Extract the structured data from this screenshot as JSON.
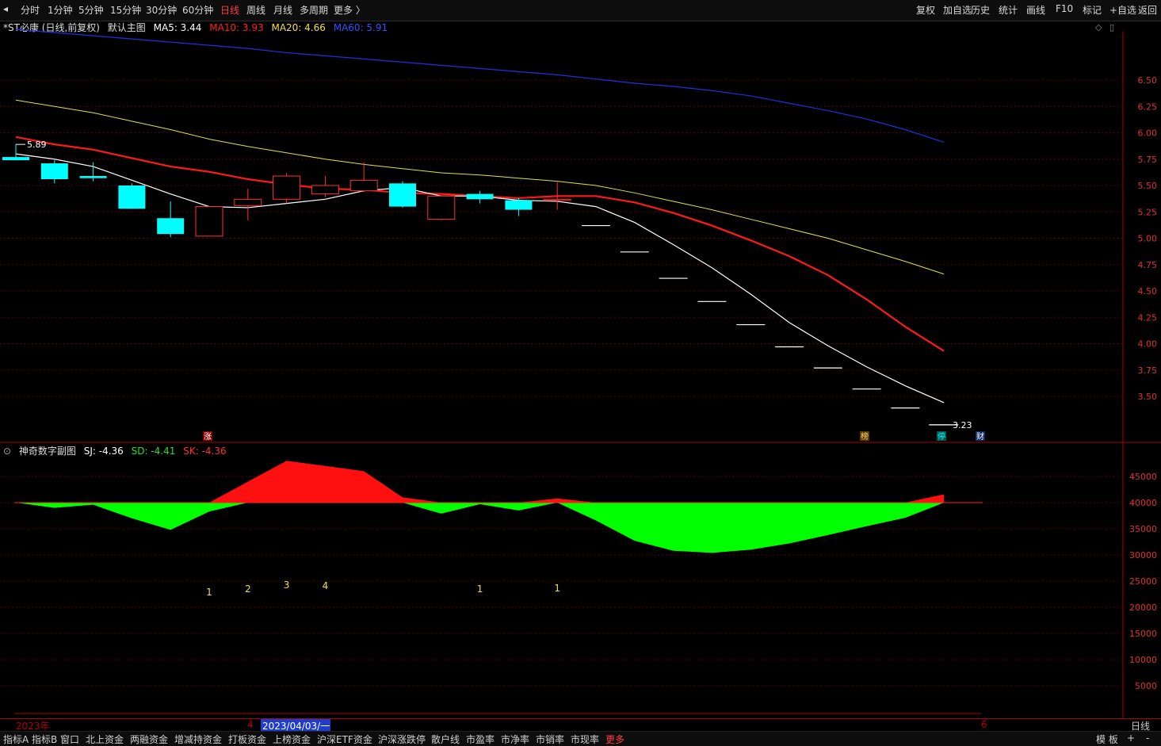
{
  "toolbar": {
    "left_buttons": [
      "分时",
      "1分钟",
      "5分钟",
      "15分钟",
      "30分钟",
      "60分钟",
      "日线",
      "周线",
      "月线",
      "多周期",
      "更多 〉"
    ],
    "active": "日线",
    "right_buttons": [
      "复权",
      "加自选",
      "历史",
      "统计",
      "画线",
      "F10",
      "标记",
      "+自选",
      "返回"
    ]
  },
  "main_legend": {
    "title": "*ST必康 (日线,前复权)",
    "template": "默认主图",
    "ma5": "MA5: 3.44",
    "ma10": "MA10: 3.93",
    "ma20": "MA20: 4.66",
    "ma60": "MA60: 5.91"
  },
  "sub_legend": {
    "title": "神奇数字副图",
    "sj": "SJ: -4.36",
    "sd": "SD: -4.41",
    "sk": "SK: -4.36"
  },
  "annotations": {
    "high_label": "5.89",
    "low_label": "3.23",
    "tag_zhang": "涨",
    "tag_bang": "榜",
    "tag_ting": "停",
    "tag_cai": "财"
  },
  "counts": [
    "1",
    "2",
    "3",
    "4",
    "1",
    "1"
  ],
  "date_axis": {
    "start": "2023年",
    "mid": "4",
    "cursor": "2023/04/03/一",
    "end": "6",
    "period": "日线"
  },
  "bottom_tabs": [
    "指标A",
    "指标B",
    "窗口",
    "北上资金",
    "两融资金",
    "增减持资金",
    "打板资金",
    "上榜资金",
    "沪深ETF资金",
    "沪深涨跌停",
    "散户线",
    "市盈率",
    "市净率",
    "市销率",
    "市现率",
    "更多"
  ],
  "bottom_right": [
    "模 板",
    "+",
    "-"
  ],
  "chart_data": {
    "type": "candlestick",
    "price_axis": {
      "ticks": [
        "6.50",
        "6.25",
        "6.00",
        "5.75",
        "5.50",
        "5.25",
        "5.00",
        "4.75",
        "4.50",
        "4.25",
        "4.00",
        "3.75",
        "3.50"
      ]
    },
    "candles": [
      {
        "open": 5.77,
        "close": 5.74,
        "high": 5.89,
        "low": 5.74,
        "up": false
      },
      {
        "open": 5.71,
        "close": 5.56,
        "high": 5.74,
        "low": 5.52,
        "up": false
      },
      {
        "open": 5.59,
        "close": 5.57,
        "high": 5.72,
        "low": 5.54,
        "up": false
      },
      {
        "open": 5.5,
        "close": 5.28,
        "high": 5.52,
        "low": 5.28,
        "up": false
      },
      {
        "open": 5.19,
        "close": 5.04,
        "high": 5.35,
        "low": 5.01,
        "up": false
      },
      {
        "open": 5.02,
        "close": 5.3,
        "high": 5.3,
        "low": 5.02,
        "up": true
      },
      {
        "open": 5.31,
        "close": 5.37,
        "high": 5.47,
        "low": 5.17,
        "up": true
      },
      {
        "open": 5.37,
        "close": 5.59,
        "high": 5.62,
        "low": 5.33,
        "up": true
      },
      {
        "open": 5.42,
        "close": 5.5,
        "high": 5.59,
        "low": 5.39,
        "up": true
      },
      {
        "open": 5.45,
        "close": 5.55,
        "high": 5.72,
        "low": 5.44,
        "up": true
      },
      {
        "open": 5.52,
        "close": 5.3,
        "high": 5.54,
        "low": 5.29,
        "up": false
      },
      {
        "open": 5.18,
        "close": 5.4,
        "high": 5.41,
        "low": 5.17,
        "up": true
      },
      {
        "open": 5.42,
        "close": 5.37,
        "high": 5.45,
        "low": 5.33,
        "up": false
      },
      {
        "open": 5.36,
        "close": 5.27,
        "high": 5.38,
        "low": 5.21,
        "up": false
      },
      {
        "open": 5.37,
        "close": 5.37,
        "high": 5.53,
        "low": 5.27,
        "up": true
      },
      {
        "open": 5.12,
        "close": 5.12,
        "high": 5.12,
        "low": 5.12,
        "up": false
      },
      {
        "open": 4.87,
        "close": 4.87,
        "high": 4.87,
        "low": 4.87,
        "up": false
      },
      {
        "open": 4.62,
        "close": 4.62,
        "high": 4.62,
        "low": 4.62,
        "up": false
      },
      {
        "open": 4.4,
        "close": 4.4,
        "high": 4.4,
        "low": 4.4,
        "up": false
      },
      {
        "open": 4.18,
        "close": 4.18,
        "high": 4.18,
        "low": 4.18,
        "up": false
      },
      {
        "open": 3.97,
        "close": 3.97,
        "high": 3.97,
        "low": 3.97,
        "up": false
      },
      {
        "open": 3.77,
        "close": 3.77,
        "high": 3.77,
        "low": 3.77,
        "up": false
      },
      {
        "open": 3.57,
        "close": 3.57,
        "high": 3.57,
        "low": 3.57,
        "up": false
      },
      {
        "open": 3.39,
        "close": 3.39,
        "high": 3.39,
        "low": 3.39,
        "up": false
      },
      {
        "open": 3.23,
        "close": 3.23,
        "high": 3.23,
        "low": 3.23,
        "up": false
      }
    ],
    "ma5": [
      5.8,
      5.75,
      5.68,
      5.55,
      5.42,
      5.3,
      5.29,
      5.33,
      5.37,
      5.45,
      5.48,
      5.4,
      5.4,
      5.36,
      5.35,
      5.3,
      5.15,
      4.94,
      4.72,
      4.47,
      4.2,
      3.98,
      3.78,
      3.6,
      3.44
    ],
    "ma10": [
      5.96,
      5.89,
      5.84,
      5.76,
      5.68,
      5.63,
      5.56,
      5.51,
      5.47,
      5.46,
      5.43,
      5.42,
      5.4,
      5.38,
      5.4,
      5.4,
      5.34,
      5.24,
      5.12,
      4.98,
      4.83,
      4.65,
      4.42,
      4.16,
      3.93
    ],
    "ma20": [
      6.31,
      6.25,
      6.19,
      6.11,
      6.03,
      5.94,
      5.87,
      5.81,
      5.75,
      5.7,
      5.66,
      5.62,
      5.6,
      5.57,
      5.54,
      5.5,
      5.43,
      5.35,
      5.27,
      5.18,
      5.09,
      5.0,
      4.89,
      4.78,
      4.66
    ],
    "ma60": [
      6.98,
      6.95,
      6.92,
      6.89,
      6.86,
      6.83,
      6.8,
      6.76,
      6.73,
      6.7,
      6.67,
      6.64,
      6.61,
      6.58,
      6.55,
      6.51,
      6.47,
      6.44,
      6.4,
      6.35,
      6.28,
      6.21,
      6.13,
      6.03,
      5.91
    ],
    "sub_axis": {
      "ticks": [
        "45000",
        "40000",
        "35000",
        "30000",
        "25000",
        "20000",
        "15000",
        "10000",
        "5000"
      ],
      "baseline": 40000
    },
    "sub_values": [
      40000,
      39000,
      39600,
      37000,
      34800,
      38300,
      44000,
      48000,
      47000,
      46000,
      41000,
      37900,
      39700,
      38500,
      40800,
      36600,
      32700,
      30800,
      30400,
      31000,
      32200,
      33800,
      35500,
      37100,
      41600
    ]
  }
}
